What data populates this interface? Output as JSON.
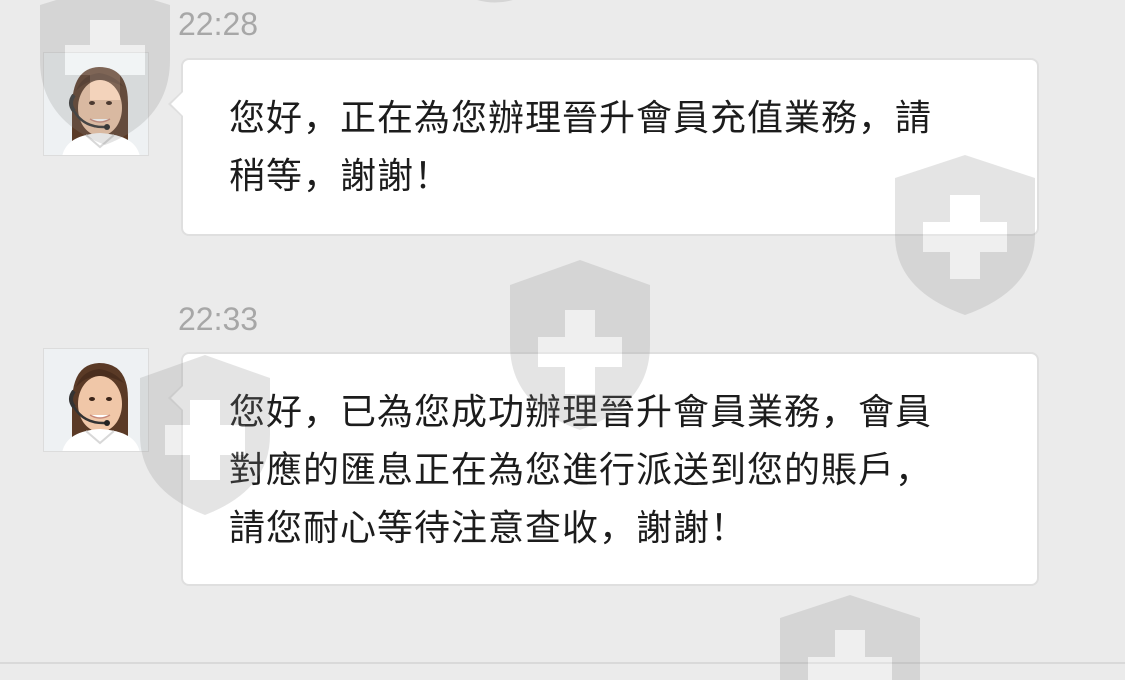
{
  "messages": [
    {
      "time": "22:28",
      "sender": "customer-service-agent",
      "lines": [
        "您好，正在為您辦理晉升會員充值業務，請",
        "稍等，謝謝！"
      ]
    },
    {
      "time": "22:33",
      "sender": "customer-service-agent",
      "lines": [
        "您好，已為您成功辦理晉升會員業務，會員",
        "對應的匯息正在為您進行派送到您的賬戶，",
        "請您耐心等待注意查收，謝謝！"
      ]
    }
  ],
  "icons": {
    "avatar": "agent-headset-avatar",
    "watermark": "shield-cross-icon"
  },
  "colors": {
    "background": "#ebebeb",
    "bubble": "#ffffff",
    "timestamp": "#a7a7a7",
    "text": "#1c1c1c"
  }
}
